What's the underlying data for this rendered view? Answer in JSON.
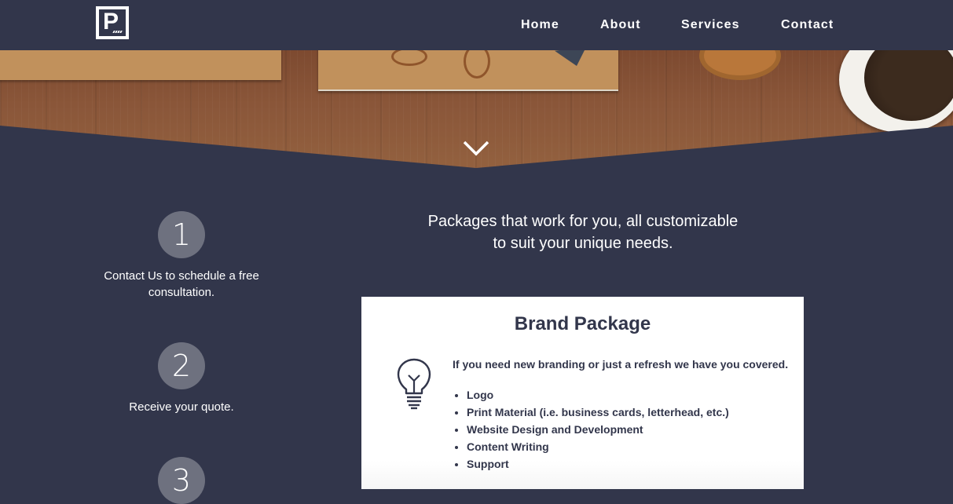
{
  "header": {
    "logo_letter": "P",
    "nav": [
      {
        "label": "Home"
      },
      {
        "label": "About"
      },
      {
        "label": "Services"
      },
      {
        "label": "Contact"
      }
    ]
  },
  "hero": {
    "scroll_icon": "chevron-down-icon"
  },
  "steps": [
    {
      "number": "1",
      "text": "Contact Us to schedule a free consultation."
    },
    {
      "number": "2",
      "text": "Receive your quote."
    },
    {
      "number": "3",
      "text": ""
    }
  ],
  "intro": {
    "line1": "Packages that work for you, all customizable",
    "line2": "to suit your unique needs."
  },
  "package": {
    "title": "Brand Package",
    "icon": "lightbulb-icon",
    "description": "If you need new branding or just a refresh we have you covered.",
    "items": [
      "Logo",
      "Print Material (i.e. business cards, letterhead, etc.)",
      "Website Design and Development",
      "Content Writing",
      "Support"
    ]
  },
  "colors": {
    "background": "#32364b",
    "step_circle": "#6e717f",
    "card": "#ffffff",
    "text_dark": "#32364b"
  }
}
